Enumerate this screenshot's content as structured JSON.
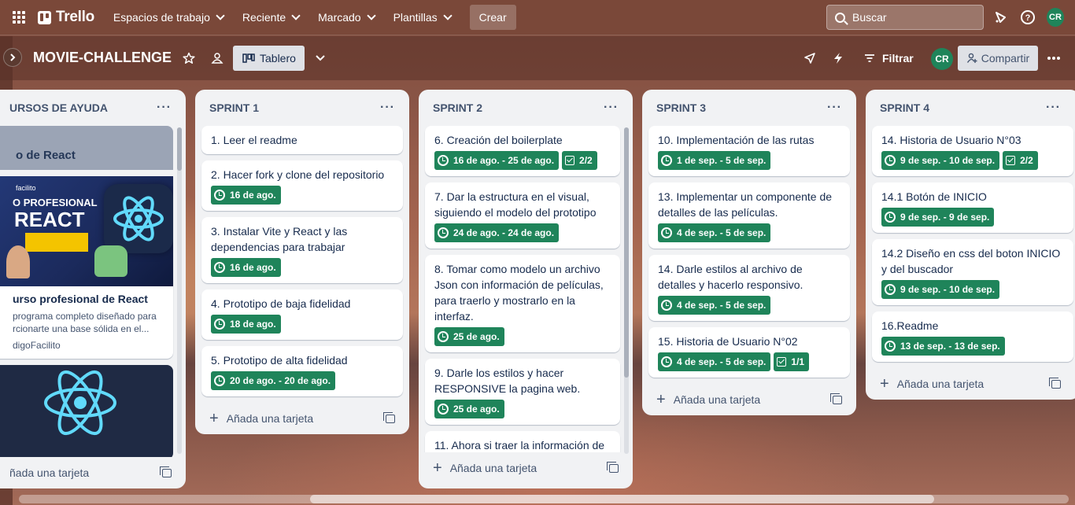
{
  "topbar": {
    "brand": "Trello",
    "nav": [
      "Espacios de trabajo",
      "Reciente",
      "Marcado",
      "Plantillas"
    ],
    "create_label": "Crear",
    "search_placeholder": "Buscar",
    "avatar_initials": "CR"
  },
  "board": {
    "title": "MOVIE-CHALLENGE",
    "view_label": "Tablero",
    "filter_label": "Filtrar",
    "member_initials": "CR",
    "share_label": "Compartir"
  },
  "lists": [
    {
      "title": "URSOS DE AYUDA",
      "cover_card": {
        "top_label": "o de React",
        "image_text": [
          "facilito",
          "O PROFESIONAL",
          "REACT"
        ],
        "title": "urso profesional de React",
        "description": "programa completo diseñado para rcionarte una base sólida en el...",
        "source": "digoFacilito"
      },
      "add_label": "ñada una tarjeta"
    },
    {
      "title": "SPRINT 1",
      "cards": [
        {
          "title": "1. Leer el readme",
          "date": null,
          "checklist": null
        },
        {
          "title": "2. Hacer fork y clone del repositorio",
          "date": "16 de ago.",
          "checklist": null
        },
        {
          "title": "3. Instalar Vite y React y las dependencias para trabajar",
          "date": "16 de ago.",
          "checklist": null
        },
        {
          "title": "4. Prototipo de baja fidelidad",
          "date": "18 de ago.",
          "checklist": null
        },
        {
          "title": "5. Prototipo de alta fidelidad",
          "date": "20 de ago. - 20 de ago.",
          "checklist": null
        }
      ],
      "add_label": "Añada una tarjeta"
    },
    {
      "title": "SPRINT 2",
      "cards": [
        {
          "title": "6. Creación del boilerplate",
          "date": "16 de ago. - 25 de ago.",
          "checklist": "2/2"
        },
        {
          "title": "7. Dar la estructura en el visual, siguiendo el modelo del prototipo",
          "date": "24 de ago. - 24 de ago.",
          "checklist": null
        },
        {
          "title": "8. Tomar como modelo un archivo Json con información de películas, para traerlo y mostrarlo en la interfaz.",
          "date": "25 de ago.",
          "checklist": null
        },
        {
          "title": "9. Darle los estilos y hacer RESPONSIVE la pagina web.",
          "date": "25 de ago.",
          "checklist": null
        },
        {
          "title": "11. Ahora si traer la información de",
          "date": null,
          "checklist": null
        }
      ],
      "add_label": "Añada una tarjeta"
    },
    {
      "title": "SPRINT 3",
      "cards": [
        {
          "title": "10. Implementación de las rutas",
          "date": "1 de sep. - 5 de sep.",
          "checklist": null
        },
        {
          "title": "13. Implementar un componente de detalles de las películas.",
          "date": "4 de sep. - 5 de sep.",
          "checklist": null
        },
        {
          "title": "14. Darle estilos al archivo de detalles y hacerlo responsivo.",
          "date": "4 de sep. - 5 de sep.",
          "checklist": null
        },
        {
          "title": "15. Historia de Usuario N°02",
          "date": "4 de sep. - 5 de sep.",
          "checklist": "1/1"
        }
      ],
      "add_label": "Añada una tarjeta"
    },
    {
      "title": "SPRINT 4",
      "cards": [
        {
          "title": "14. Historia de Usuario N°03",
          "date": "9 de sep. - 10 de sep.",
          "checklist": "2/2"
        },
        {
          "title": "14.1 Botón de INICIO",
          "date": "9 de sep. - 9 de sep.",
          "checklist": null
        },
        {
          "title": "14.2 Diseño en css del boton INICIO y del buscador",
          "date": "9 de sep. - 10 de sep.",
          "checklist": null
        },
        {
          "title": "16.Readme",
          "date": "13 de sep. - 13 de sep.",
          "checklist": null
        }
      ],
      "add_label": "Añada una tarjeta"
    }
  ]
}
